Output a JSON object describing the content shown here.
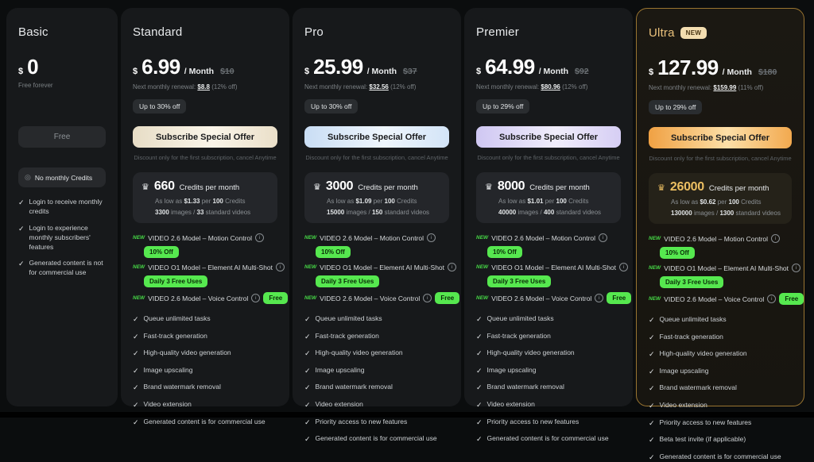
{
  "colors": {
    "badge_green": "#56e84f",
    "ultra_gold": "#eac17b",
    "cta_text": "#1a1b1d"
  },
  "plans": [
    {
      "key": "basic",
      "name": "Basic",
      "price": {
        "currency": "$",
        "amount": "0"
      },
      "tagline": "Free forever",
      "cta": "Free",
      "credits_pill": "No monthly Credits",
      "checks": [
        "Login to receive monthly credits",
        "Login to experience monthly subscribers' features",
        "Generated content is not for commercial use"
      ]
    },
    {
      "key": "standard",
      "name": "Standard",
      "tag": "",
      "price": {
        "currency": "$",
        "amount": "6.99",
        "per": "/ Month",
        "old": "$10"
      },
      "renewal": {
        "prefix": "Next monthly renewal:",
        "amount": "$8.8",
        "off": "(12% off)"
      },
      "discount_chip": "Up to 30% off",
      "cta": "Subscribe Special Offer",
      "cta_note": "Discount only for the first subscription, cancel Anytime",
      "credits": {
        "amount": "660",
        "unit": "Credits per month",
        "rate_prefix": "As low as",
        "rate_price": "$1.33",
        "rate_mid": "per",
        "rate_qty": "100",
        "rate_unit": "Credits",
        "images_num": "3300",
        "images_word": "images",
        "sep": "/",
        "videos_num": "33",
        "videos_word": "standard videos"
      },
      "models": [
        {
          "tag": "NEW",
          "name": "VIDEO 2.6 Model – Motion Control",
          "badge": "10% Off",
          "badge_placement": "below"
        },
        {
          "tag": "NEW",
          "name": "VIDEO O1 Model – Element AI Multi-Shot",
          "badge": "Daily 3 Free Uses",
          "badge_placement": "below"
        },
        {
          "tag": "NEW",
          "name": "VIDEO 2.6 Model – Voice Control",
          "badge": "Free",
          "badge_placement": "inline"
        }
      ],
      "checks": [
        "Queue unlimited tasks",
        "Fast-track generation",
        "High-quality video generation",
        "Image upscaling",
        "Brand watermark removal",
        "Video extension",
        "Generated content is for commercial use"
      ]
    },
    {
      "key": "pro",
      "name": "Pro",
      "tag": "",
      "price": {
        "currency": "$",
        "amount": "25.99",
        "per": "/ Month",
        "old": "$37"
      },
      "renewal": {
        "prefix": "Next monthly renewal:",
        "amount": "$32.56",
        "off": "(12% off)"
      },
      "discount_chip": "Up to 30% off",
      "cta": "Subscribe Special Offer",
      "cta_note": "Discount only for the first subscription, cancel Anytime",
      "credits": {
        "amount": "3000",
        "unit": "Credits per month",
        "rate_prefix": "As low as",
        "rate_price": "$1.09",
        "rate_mid": "per",
        "rate_qty": "100",
        "rate_unit": "Credits",
        "images_num": "15000",
        "images_word": "images",
        "sep": "/",
        "videos_num": "150",
        "videos_word": "standard videos"
      },
      "models": [
        {
          "tag": "NEW",
          "name": "VIDEO 2.6 Model – Motion Control",
          "badge": "10% Off",
          "badge_placement": "below"
        },
        {
          "tag": "NEW",
          "name": "VIDEO O1 Model – Element AI Multi-Shot",
          "badge": "Daily 3 Free Uses",
          "badge_placement": "below"
        },
        {
          "tag": "NEW",
          "name": "VIDEO 2.6 Model – Voice Control",
          "badge": "Free",
          "badge_placement": "inline"
        }
      ],
      "checks": [
        "Queue unlimited tasks",
        "Fast-track generation",
        "High-quality video generation",
        "Image upscaling",
        "Brand watermark removal",
        "Video extension",
        "Priority access to new features",
        "Generated content is for commercial use"
      ]
    },
    {
      "key": "premier",
      "name": "Premier",
      "tag": "",
      "price": {
        "currency": "$",
        "amount": "64.99",
        "per": "/ Month",
        "old": "$92"
      },
      "renewal": {
        "prefix": "Next monthly renewal:",
        "amount": "$80.96",
        "off": "(12% off)"
      },
      "discount_chip": "Up to 29% off",
      "cta": "Subscribe Special Offer",
      "cta_note": "Discount only for the first subscription, cancel Anytime",
      "credits": {
        "amount": "8000",
        "unit": "Credits per month",
        "rate_prefix": "As low as",
        "rate_price": "$1.01",
        "rate_mid": "per",
        "rate_qty": "100",
        "rate_unit": "Credits",
        "images_num": "40000",
        "images_word": "images",
        "sep": "/",
        "videos_num": "400",
        "videos_word": "standard videos"
      },
      "models": [
        {
          "tag": "NEW",
          "name": "VIDEO 2.6 Model – Motion Control",
          "badge": "10% Off",
          "badge_placement": "below"
        },
        {
          "tag": "NEW",
          "name": "VIDEO O1 Model – Element AI Multi-Shot",
          "badge": "Daily 3 Free Uses",
          "badge_placement": "below"
        },
        {
          "tag": "NEW",
          "name": "VIDEO 2.6 Model – Voice Control",
          "badge": "Free",
          "badge_placement": "inline"
        }
      ],
      "checks": [
        "Queue unlimited tasks",
        "Fast-track generation",
        "High-quality video generation",
        "Image upscaling",
        "Brand watermark removal",
        "Video extension",
        "Priority access to new features",
        "Generated content is for commercial use"
      ]
    },
    {
      "key": "ultra",
      "name": "Ultra",
      "tag": "NEW",
      "price": {
        "currency": "$",
        "amount": "127.99",
        "per": "/ Month",
        "old": "$180"
      },
      "renewal": {
        "prefix": "Next monthly renewal:",
        "amount": "$159.99",
        "off": "(11% off)"
      },
      "discount_chip": "Up to 29% off",
      "cta": "Subscribe Special Offer",
      "cta_note": "Discount only for the first subscription, cancel Anytime",
      "credits": {
        "amount": "26000",
        "unit": "Credits per month",
        "rate_prefix": "As low as",
        "rate_price": "$0.62",
        "rate_mid": "per",
        "rate_qty": "100",
        "rate_unit": "Credits",
        "images_num": "130000",
        "images_word": "images",
        "sep": "/",
        "videos_num": "1300",
        "videos_word": "standard videos"
      },
      "models": [
        {
          "tag": "NEW",
          "name": "VIDEO 2.6 Model – Motion Control",
          "badge": "10% Off",
          "badge_placement": "below"
        },
        {
          "tag": "NEW",
          "name": "VIDEO O1 Model – Element AI Multi-Shot",
          "badge": "Daily 3 Free Uses",
          "badge_placement": "below"
        },
        {
          "tag": "NEW",
          "name": "VIDEO 2.6 Model – Voice Control",
          "badge": "Free",
          "badge_placement": "inline"
        }
      ],
      "checks": [
        "Queue unlimited tasks",
        "Fast-track generation",
        "High-quality video generation",
        "Image upscaling",
        "Brand watermark removal",
        "Video extension",
        "Priority access to new features",
        "Beta test invite (if applicable)",
        "Generated content is for commercial use"
      ]
    }
  ]
}
